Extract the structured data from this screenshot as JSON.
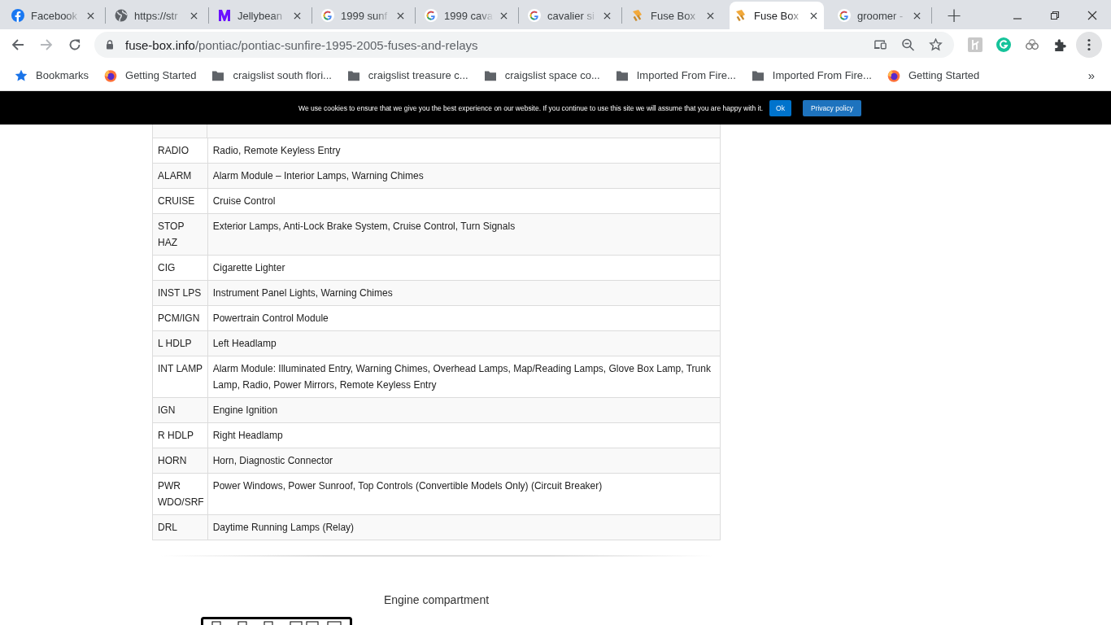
{
  "tabs": [
    {
      "title": "Facebook",
      "kind": "facebook",
      "selected": false
    },
    {
      "title": "https://str",
      "kind": "globe",
      "selected": false
    },
    {
      "title": "Jellybean",
      "kind": "jellybean",
      "selected": false
    },
    {
      "title": "1999 sunf",
      "kind": "google",
      "selected": false
    },
    {
      "title": "1999 cava",
      "kind": "google",
      "selected": false
    },
    {
      "title": "cavalier si",
      "kind": "google",
      "selected": false
    },
    {
      "title": "Fuse Box",
      "kind": "fuse",
      "selected": false
    },
    {
      "title": "Fuse Box",
      "kind": "fuse",
      "selected": true
    },
    {
      "title": "groomer -",
      "kind": "google",
      "selected": false
    }
  ],
  "new_tab": "+",
  "address_bar": {
    "domain": "fuse-box.info",
    "path": "/pontiac/pontiac-sunfire-1995-2005-fuses-and-relays"
  },
  "nav": {
    "forward_disabled": true
  },
  "bookmarks": [
    {
      "label": "Bookmarks",
      "kind": "star"
    },
    {
      "label": "Getting Started",
      "kind": "firefox"
    },
    {
      "label": "craigslist south flori...",
      "kind": "folder"
    },
    {
      "label": "craigslist treasure c...",
      "kind": "folder"
    },
    {
      "label": "craigslist space co...",
      "kind": "folder"
    },
    {
      "label": "Imported From Fire...",
      "kind": "folder"
    },
    {
      "label": "Imported From Fire...",
      "kind": "folder"
    },
    {
      "label": "Getting Started",
      "kind": "firefox"
    }
  ],
  "bookmarks_more": "»",
  "cookie_notice": {
    "text": "We use cookies to ensure that we give you the best experience on our website. If you continue to use this site we will assume that you are happy with it.",
    "ok": "Ok",
    "policy": "Privacy policy"
  },
  "fuse_table": [
    {
      "fuse": "RADIO",
      "description": "Radio, Remote Keyless Entry"
    },
    {
      "fuse": "ALARM",
      "description": "Alarm Module – Interior Lamps, Warning Chimes"
    },
    {
      "fuse": "CRUISE",
      "description": "Cruise Control"
    },
    {
      "fuse": "STOP HAZ",
      "description": "Exterior Lamps, Anti-Lock Brake System, Cruise Control, Turn Signals"
    },
    {
      "fuse": "CIG",
      "description": "Cigarette Lighter"
    },
    {
      "fuse": "INST LPS",
      "description": "Instrument Panel Lights, Warning Chimes"
    },
    {
      "fuse": "PCM/IGN",
      "description": "Powertrain Control Module"
    },
    {
      "fuse": "L HDLP",
      "description": "Left Headlamp"
    },
    {
      "fuse": "INT LAMP",
      "description": "Alarm Module: Illuminated Entry, Warning Chimes, Overhead Lamps, Map/Reading Lamps, Glove Box Lamp, Trunk Lamp, Radio, Power Mirrors, Remote Keyless Entry"
    },
    {
      "fuse": "IGN",
      "description": "Engine Ignition"
    },
    {
      "fuse": "R HDLP",
      "description": "Right Headlamp"
    },
    {
      "fuse": "HORN",
      "description": "Horn, Diagnostic Connector"
    },
    {
      "fuse": "PWR WDO/SRF",
      "description": "Power Windows, Power Sunroof, Top Controls (Convertible Models Only) (Circuit Breaker)"
    },
    {
      "fuse": "DRL",
      "description": "Daytime Running Lamps (Relay)"
    }
  ],
  "section_caption": "Engine compartment"
}
